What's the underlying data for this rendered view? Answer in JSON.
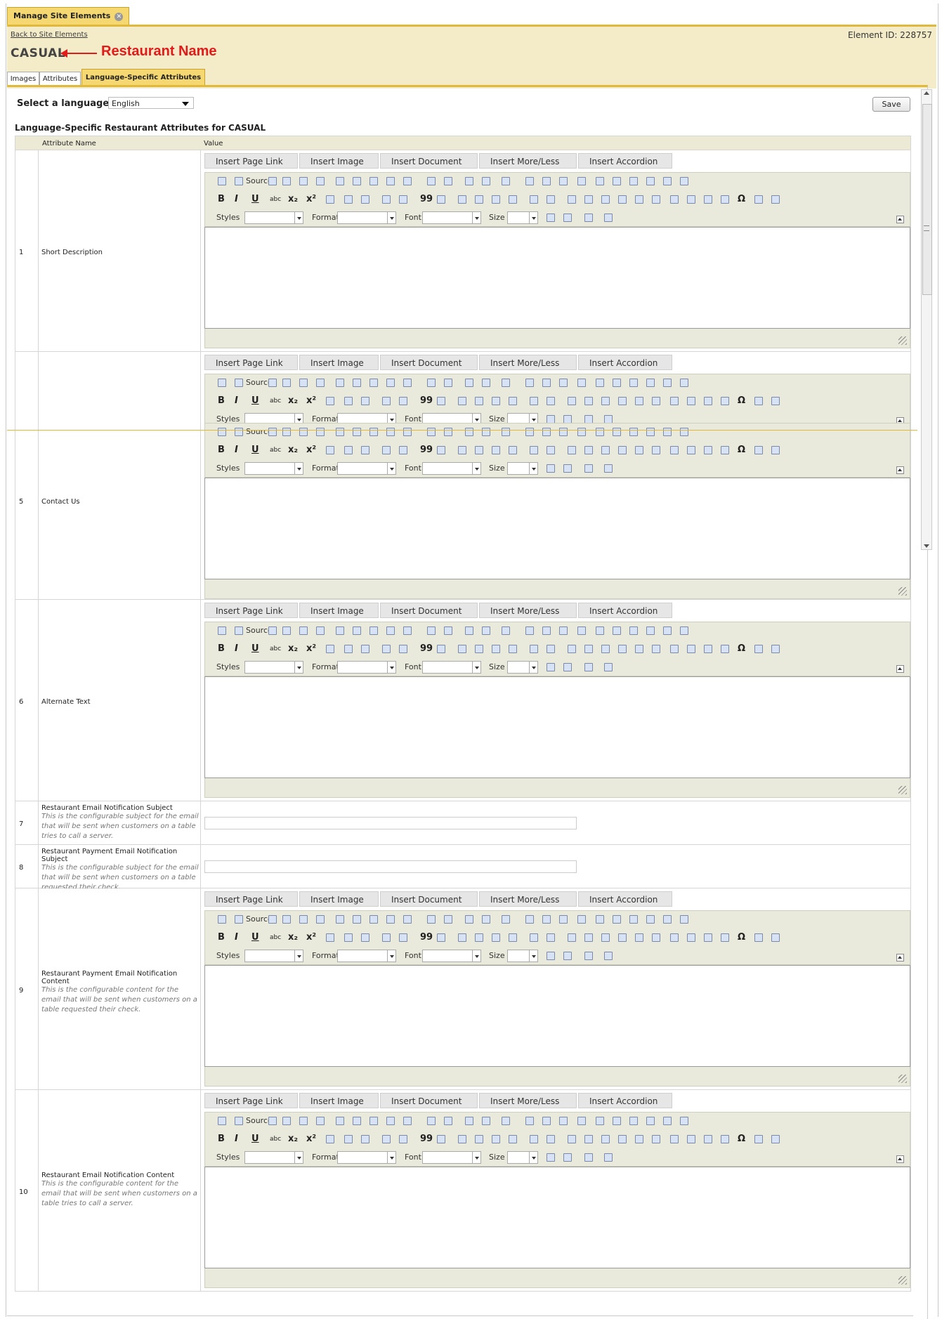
{
  "header": {
    "top_tab": "Manage Site Elements",
    "back_link": "Back to Site Elements",
    "element_id": "Element ID: 228757",
    "restaurant_name": "CASUAL",
    "annotation": "Restaurant Name"
  },
  "tabs": [
    "Images",
    "Attributes",
    "Language-Specific Attributes"
  ],
  "language": {
    "label": "Select a language:",
    "selected": "English"
  },
  "save_label": "Save",
  "section_title": "Language-Specific Restaurant Attributes for CASUAL",
  "table": {
    "col_name": "Attribute Name",
    "col_value": "Value"
  },
  "editor": {
    "buttons": [
      "Insert Page Link",
      "Insert Image",
      "Insert Document",
      "Insert More/Less",
      "Insert Accordion"
    ],
    "source_label": "Source",
    "styles_label": "Styles",
    "format_label": "Format",
    "font_label": "Font",
    "size_label": "Size"
  },
  "rows": [
    {
      "num": "1",
      "name": "Short Description",
      "desc": ""
    },
    {
      "num": "5",
      "name": "Contact Us",
      "desc": ""
    },
    {
      "num": "6",
      "name": "Alternate Text",
      "desc": ""
    },
    {
      "num": "7",
      "name": "Restaurant Email Notification Subject",
      "desc": "This is the configurable subject for the email that will be sent when customers on a table tries to call a server."
    },
    {
      "num": "8",
      "name": "Restaurant Payment Email Notification Subject",
      "desc": "This is the configurable subject for the email that will be sent when customers on a table requested their check."
    },
    {
      "num": "9",
      "name": "Restaurant Payment Email Notification Content",
      "desc": "This is the configurable content for the email that will be sent when customers on a table requested their check."
    },
    {
      "num": "10",
      "name": "Restaurant Email Notification Content",
      "desc": "This is the configurable content for the email that will be sent when customers on a table tries to call a server."
    }
  ]
}
